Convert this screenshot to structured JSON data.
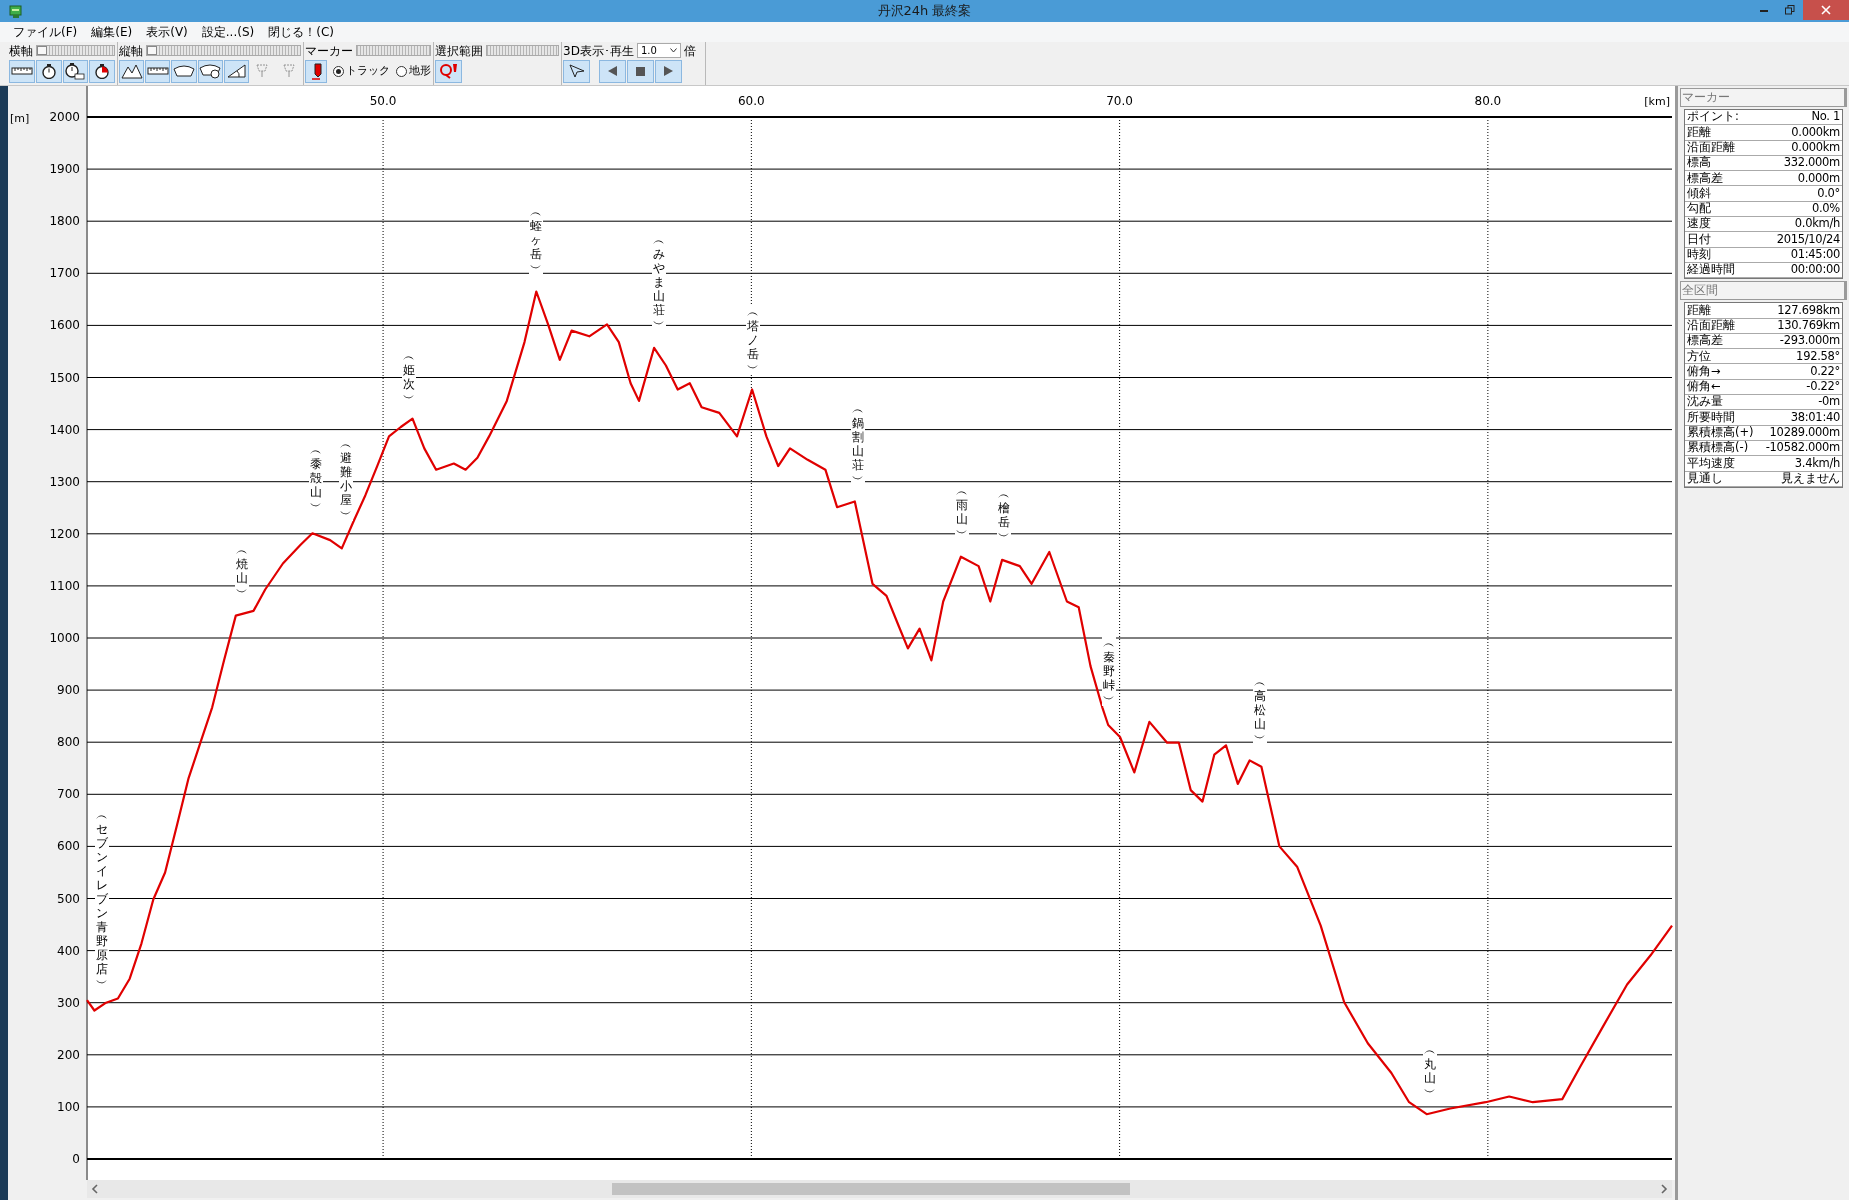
{
  "window": {
    "title": "丹沢24h 最終案"
  },
  "menu": [
    "ファイル(F)",
    "編集(E)",
    "表示(V)",
    "設定...(S)",
    "閉じる！(C)"
  ],
  "toolbar": [
    {
      "label": "横軸",
      "slider": {
        "level": 0
      },
      "buttons": [
        {
          "disabled": false
        },
        {
          "disabled": false
        },
        {
          "disabled": false
        },
        {
          "disabled": false
        }
      ]
    },
    {
      "label": "縦軸",
      "slider": {
        "level": 0
      },
      "buttons": [
        {
          "disabled": false
        },
        {
          "disabled": false
        },
        {
          "disabled": false
        },
        {
          "disabled": false
        },
        {
          "disabled": false
        },
        {
          "disabled": true
        },
        {
          "disabled": true
        }
      ]
    },
    {
      "label": "マーカー",
      "buttons": [
        {
          "disabled": false
        }
      ],
      "radios": [
        {
          "label": "トラック",
          "selected": true
        },
        {
          "label": "地形",
          "selected": false
        }
      ]
    },
    {
      "label": "選択範囲",
      "buttons": [
        {
          "disabled": false
        }
      ]
    },
    {
      "label": "3D表示･再生",
      "select": {
        "value": "1.0"
      },
      "suffix": "倍",
      "buttons": [
        {
          "disabled": false
        },
        {
          "disabled": false
        },
        {
          "disabled": false
        },
        {
          "disabled": false
        }
      ]
    }
  ],
  "chart": {
    "chart_data": {
      "type": "line",
      "xlabel": "[km]",
      "ylabel": "[m]",
      "xlim": [
        41.96,
        85.0
      ],
      "ylim": [
        0,
        2000
      ],
      "xticks": [
        {
          "value": 50,
          "label": "50.0"
        },
        {
          "value": 60,
          "label": "60.0"
        },
        {
          "value": 70,
          "label": "70.0"
        },
        {
          "value": 80,
          "label": "80.0"
        }
      ],
      "yticks": [
        0,
        100,
        200,
        300,
        400,
        500,
        600,
        700,
        800,
        900,
        1000,
        1100,
        1200,
        1300,
        1400,
        1500,
        1600,
        1700,
        1800,
        1900,
        2000
      ],
      "x": [
        41.96,
        42.16,
        42.48,
        42.8,
        43.12,
        43.44,
        43.76,
        44.08,
        44.4,
        44.72,
        45.04,
        45.36,
        45.68,
        46.0,
        46.48,
        46.8,
        47.28,
        47.76,
        48.08,
        48.56,
        48.88,
        49.2,
        49.52,
        49.84,
        50.16,
        50.48,
        50.8,
        51.12,
        51.44,
        51.92,
        52.24,
        52.56,
        52.88,
        53.36,
        53.84,
        54.16,
        54.48,
        54.8,
        55.12,
        55.6,
        56.08,
        56.4,
        56.72,
        56.95,
        57.36,
        57.68,
        58.0,
        58.33,
        58.65,
        59.13,
        59.61,
        60.02,
        60.41,
        60.73,
        61.05,
        61.53,
        62.01,
        62.33,
        62.81,
        63.29,
        63.67,
        63.99,
        64.25,
        64.57,
        64.89,
        65.21,
        65.69,
        66.17,
        66.49,
        66.81,
        67.29,
        67.61,
        68.09,
        68.57,
        68.89,
        69.21,
        69.53,
        69.69,
        70.01,
        70.4,
        70.81,
        71.29,
        71.61,
        71.93,
        72.25,
        72.57,
        72.89,
        73.21,
        73.53,
        73.85,
        74.34,
        74.82,
        75.46,
        76.1,
        76.74,
        77.38,
        77.86,
        78.34,
        78.98,
        79.94,
        80.58,
        81.22,
        82.02,
        82.5,
        83.14,
        83.78,
        84.42,
        85.0
      ],
      "grid": true,
      "series": [
        {
          "color": "#e00000",
          "values": [
            305,
            285,
            300,
            308,
            346,
            414,
            498,
            550,
            640,
            731,
            799,
            867,
            957,
            1043,
            1052,
            1093,
            1143,
            1179,
            1201,
            1188,
            1172,
            1224,
            1274,
            1330,
            1387,
            1405,
            1421,
            1364,
            1323,
            1335,
            1323,
            1346,
            1387,
            1455,
            1568,
            1665,
            1602,
            1534,
            1590,
            1579,
            1602,
            1568,
            1489,
            1455,
            1557,
            1523,
            1477,
            1489,
            1443,
            1432,
            1387,
            1477,
            1387,
            1330,
            1364,
            1342,
            1323,
            1251,
            1262,
            1104,
            1081,
            1025,
            980,
            1018,
            957,
            1070,
            1156,
            1138,
            1070,
            1150,
            1138,
            1104,
            1165,
            1070,
            1059,
            946,
            867,
            833,
            810,
            742,
            839,
            799,
            799,
            708,
            686,
            776,
            794,
            720,
            765,
            753,
            600,
            561,
            448,
            301,
            222,
            165,
            109,
            86,
            97,
            109,
            120,
            109,
            115,
            176,
            256,
            335,
            391,
            448
          ]
        }
      ],
      "annotations": [
        "︵セブンイレブン青野原店︶",
        "︵焼山︶",
        "︵黍殻山︶",
        "︵避難小屋︶",
        "︵姫次︶",
        "︵蛭ヶ岳︶",
        "︵みやま山荘︶",
        "︵塔ノ岳︶",
        "︵鍋割山荘︶",
        "︵雨山︶",
        "︵檜岳︶",
        "︵秦野峠︶",
        "︵高松山︶",
        "︵丸山︶"
      ]
    }
  },
  "panel": [
    {
      "title": "マーカー",
      "rows": [
        {
          "label": "ポイント:",
          "value": "No. 1"
        },
        {
          "label": "距離",
          "value": "0.000km"
        },
        {
          "label": "沿面距離",
          "value": "0.000km"
        },
        {
          "label": "標高",
          "value": "332.000m"
        },
        {
          "label": "標高差",
          "value": "0.000m"
        },
        {
          "label": "傾斜",
          "value": "0.0°"
        },
        {
          "label": "勾配",
          "value": "0.0%"
        },
        {
          "label": "速度",
          "value": "0.0km/h"
        },
        {
          "label": "日付",
          "value": "2015/10/24"
        },
        {
          "label": "時刻",
          "value": "01:45:00"
        },
        {
          "label": "経過時間",
          "value": "00:00:00"
        }
      ]
    },
    {
      "title": "全区間",
      "rows": [
        {
          "label": "距離",
          "value": "127.698km"
        },
        {
          "label": "沿面距離",
          "value": "130.769km"
        },
        {
          "label": "標高差",
          "value": "-293.000m"
        },
        {
          "label": "方位",
          "value": "192.58°"
        },
        {
          "label": "俯角→",
          "value": "0.22°"
        },
        {
          "label": "俯角←",
          "value": "-0.22°"
        },
        {
          "label": "沈み量",
          "value": "-0m"
        },
        {
          "label": "所要時間",
          "value": "38:01:40"
        },
        {
          "label": "累積標高(+)",
          "value": "10289.000m"
        },
        {
          "label": "累積標高(-)",
          "value": "-10582.000m"
        },
        {
          "label": "平均速度",
          "value": "3.4km/h"
        },
        {
          "label": "見通し",
          "value": "見えません"
        }
      ]
    }
  ]
}
